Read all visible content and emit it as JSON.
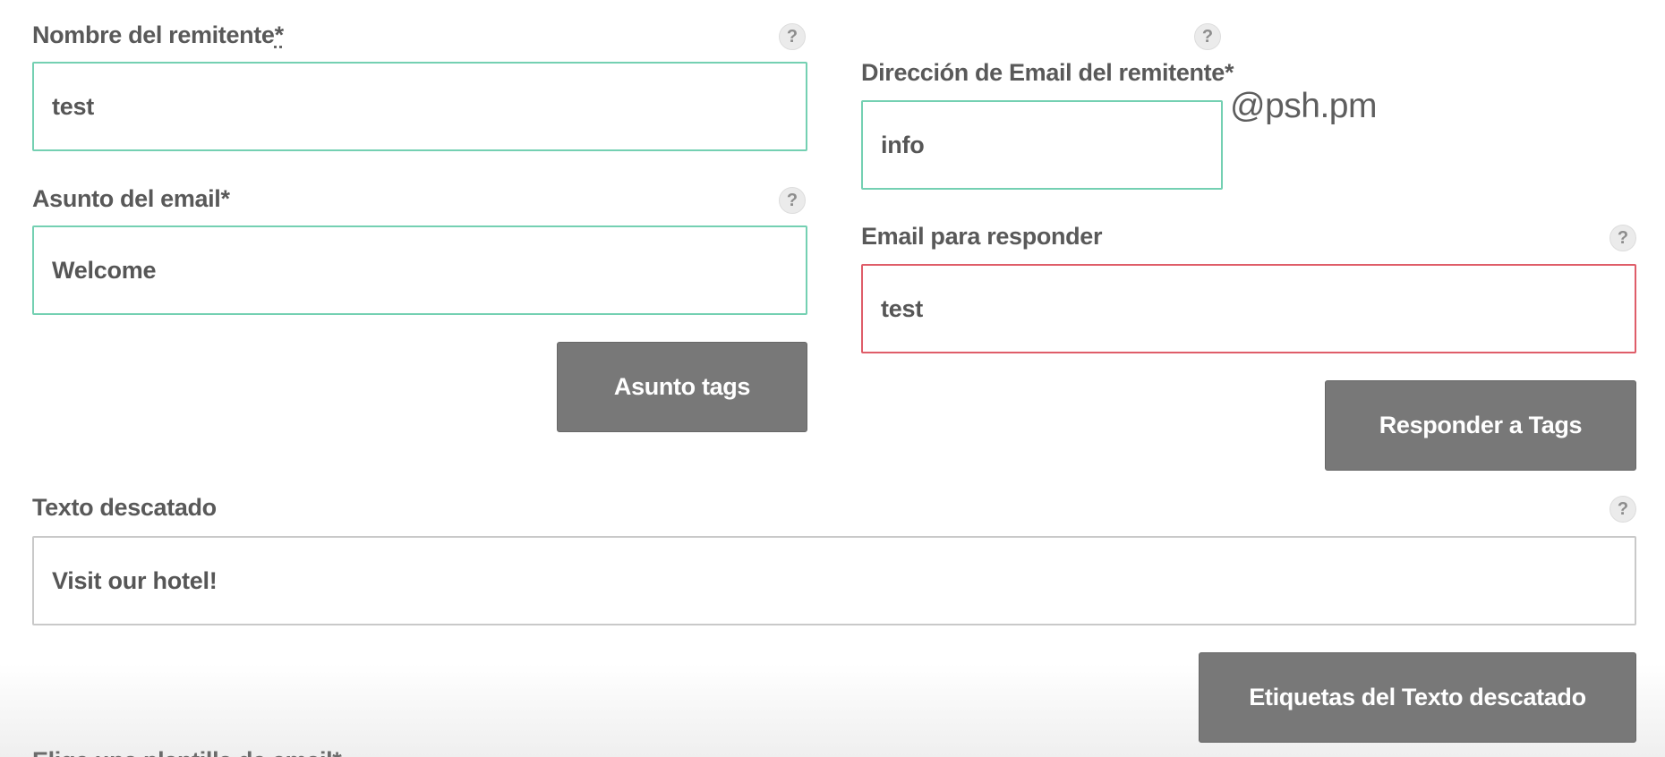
{
  "form": {
    "sender_name": {
      "label": "Nombre del remitente",
      "required_mark": "*",
      "value": "test",
      "help": "?"
    },
    "subject": {
      "label": "Asunto del email*",
      "value": "Welcome",
      "help": "?"
    },
    "subject_tags_button": "Asunto tags",
    "sender_email": {
      "label": "Dirección de Email del remitente*",
      "value": "info",
      "domain": "@psh.pm",
      "help": "?"
    },
    "reply_email": {
      "label": "Email para responder",
      "value": "test",
      "help": "?"
    },
    "reply_tags_button": "Responder a Tags",
    "highlighted_text": {
      "label": "Texto descatado",
      "value": "Visit our hotel!",
      "help": "?"
    },
    "highlighted_tags_button": "Etiquetas del Texto descatado",
    "template_label": "Elige una plantilla de email*"
  },
  "colors": {
    "valid_border": "#74d0b2",
    "error_border": "#df5d69",
    "neutral_border": "#c9c9c9",
    "button_bg": "#787878",
    "help_bg": "#ebebeb"
  },
  "icons": {
    "help": "question-mark-circle-icon"
  }
}
